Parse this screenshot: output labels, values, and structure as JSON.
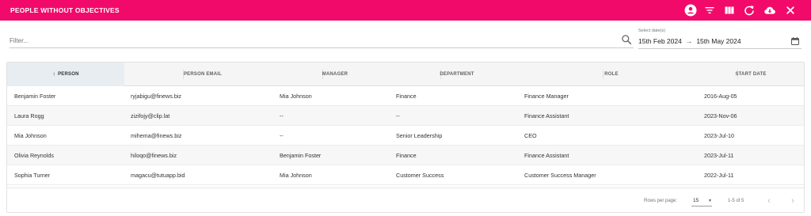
{
  "header": {
    "title": "PEOPLE WITHOUT OBJECTIVES",
    "background": "#f20a6b",
    "icons": [
      "account-icon",
      "filter-icon",
      "columns-icon",
      "refresh-icon",
      "cloud-download-icon",
      "close-icon"
    ]
  },
  "filter": {
    "placeholder": "Filter...",
    "value": ""
  },
  "date_range": {
    "label": "Select date(s)",
    "start": "15th Feb 2024",
    "separator": "→",
    "end": "15th May 2024"
  },
  "table": {
    "columns": [
      "PERSON",
      "PERSON EMAIL",
      "MANAGER",
      "DEPARTMENT",
      "ROLE",
      "START DATE"
    ],
    "sorted_column": "PERSON",
    "rows": [
      {
        "person": "Benjamin Foster",
        "email": "ryjabigu@finews.biz",
        "manager": "Mia Johnson",
        "department": "Finance",
        "role": "Finance Manager",
        "start": "2016-Aug-05"
      },
      {
        "person": "Laura Rogg",
        "email": "zizifojy@clip.lat",
        "manager": "--",
        "department": "--",
        "role": "Finance Assistant",
        "start": "2023-Nov-06"
      },
      {
        "person": "Mia Johnson",
        "email": "mihema@finews.biz",
        "manager": "--",
        "department": "Senior Leadership",
        "role": "CEO",
        "start": "2023-Jul-10"
      },
      {
        "person": "Olivia Reynolds",
        "email": "hiloqo@finews.biz",
        "manager": "Benjamin Foster",
        "department": "Finance",
        "role": "Finance Assistant",
        "start": "2023-Jul-11"
      },
      {
        "person": "Sophia Turner",
        "email": "magacu@tutuapp.bid",
        "manager": "Mia Johnson",
        "department": "Customer Success",
        "role": "Customer Success Manager",
        "start": "2022-Jul-11"
      }
    ]
  },
  "pagination": {
    "rows_per_page_label": "Rows per page:",
    "rows_per_page": "15",
    "range": "1-5 of 5"
  }
}
